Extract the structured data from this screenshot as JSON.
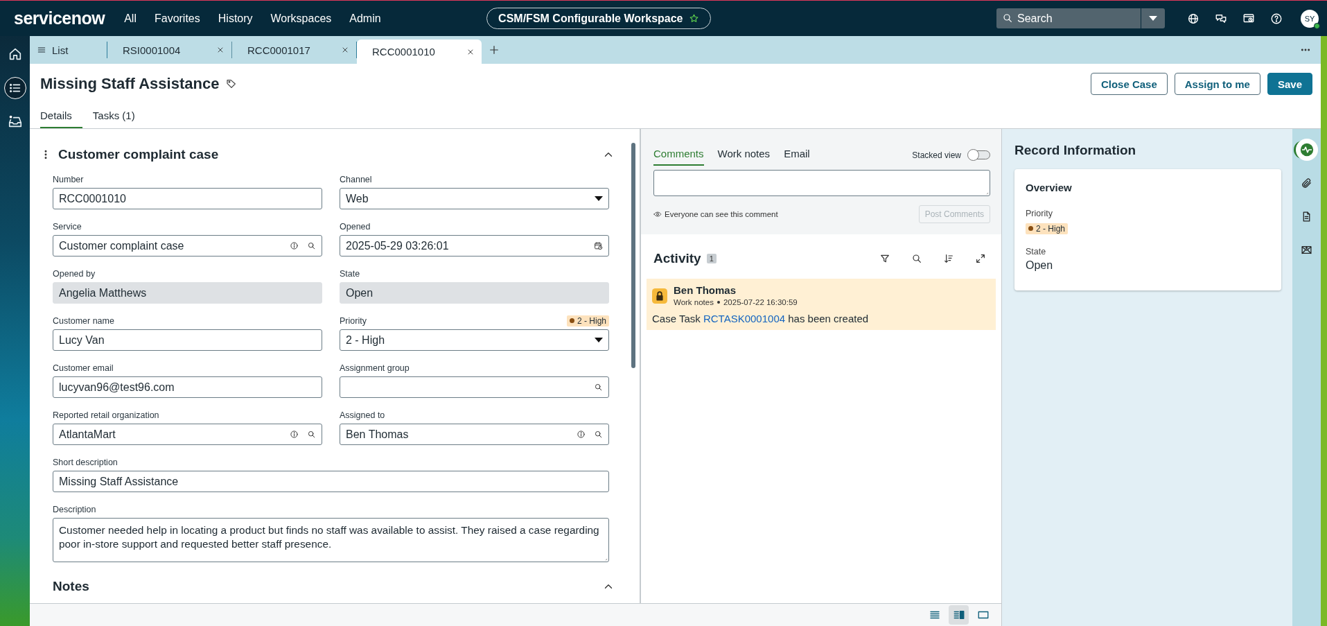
{
  "nav": {
    "logo": "servicenow",
    "menu": [
      "All",
      "Favorites",
      "History",
      "Workspaces",
      "Admin"
    ],
    "workspace": "CSM/FSM Configurable Workspace",
    "search": {
      "placeholder": "Search"
    },
    "avatar": "SY"
  },
  "left_rail": [
    {
      "kind": "home",
      "selected": false
    },
    {
      "kind": "list",
      "selected": true
    },
    {
      "kind": "inbox",
      "selected": false
    }
  ],
  "tabs": [
    {
      "label": "List",
      "kind": "list",
      "selected": false
    },
    {
      "label": "RSI0001004",
      "kind": "record",
      "selected": false
    },
    {
      "label": "RCC0001017",
      "kind": "record",
      "selected": false
    },
    {
      "label": "RCC0001010",
      "kind": "record",
      "selected": true
    }
  ],
  "record": {
    "title": "Missing Staff Assistance",
    "actions": [
      {
        "label": "Close Case",
        "kind": "secondary"
      },
      {
        "label": "Assign to me",
        "kind": "secondary"
      },
      {
        "label": "Save",
        "kind": "primary"
      }
    ],
    "tabs": [
      {
        "label": "Details",
        "selected": true
      },
      {
        "label": "Tasks (1)",
        "selected": false
      }
    ]
  },
  "form": {
    "section": "Customer complaint case",
    "fields": [
      {
        "label": "Number",
        "value": "RCC0001010",
        "kind": "text"
      },
      {
        "label": "Channel",
        "value": "Web",
        "kind": "select"
      },
      {
        "label": "Service",
        "value": "Customer complaint case",
        "kind": "reference"
      },
      {
        "label": "Opened",
        "value": "2025-05-29 03:26:01",
        "kind": "datetime"
      },
      {
        "label": "Opened by",
        "value": "Angelia Matthews",
        "kind": "readonly"
      },
      {
        "label": "State",
        "value": "Open",
        "kind": "readonly"
      },
      {
        "label": "Customer name",
        "value": "Lucy Van",
        "kind": "text"
      },
      {
        "label": "Priority",
        "value": "2 - High",
        "kind": "select",
        "badge": "2 - High"
      },
      {
        "label": "Customer email",
        "value": "lucyvan96@test96.com",
        "kind": "text"
      },
      {
        "label": "Assignment group",
        "kind": "search"
      },
      {
        "label": "Reported retail organization",
        "value": "AtlantaMart",
        "kind": "reference"
      },
      {
        "label": "Assigned to",
        "value": "Ben Thomas",
        "kind": "reference"
      },
      {
        "label": "Short description",
        "value": "Missing Staff Assistance",
        "kind": "text",
        "wide": true
      },
      {
        "label": "Description",
        "value": "Customer needed help in locating a product but finds no staff was available to assist. They raised a case regarding poor in-store support and requested better staff presence.",
        "kind": "textarea",
        "wide": true
      }
    ],
    "next_section": "Notes"
  },
  "composer": {
    "tabs": [
      {
        "label": "Comments",
        "selected": true
      },
      {
        "label": "Work notes",
        "selected": false
      },
      {
        "label": "Email",
        "selected": false
      }
    ],
    "stacked_view": {
      "label": "Stacked view",
      "on": false
    },
    "visibility_note": "Everyone can see this comment",
    "post_button": {
      "label": "Post Comments",
      "disabled": true
    }
  },
  "activity": {
    "title": "Activity",
    "count": "1",
    "entries": [
      {
        "author": "Ben Thomas",
        "type": "Work notes",
        "time": "2025-07-22 16:30:59",
        "message": [
          {
            "text": "Case Task",
            "kind": "text"
          },
          {
            "text": "RCTASK0001004",
            "kind": "link"
          },
          {
            "text": "has been created",
            "kind": "text"
          }
        ]
      }
    ]
  },
  "record_info": {
    "title": "Record Information",
    "card": "Overview",
    "fields": [
      {
        "label": "Priority",
        "value": "2 - High",
        "kind": "badge"
      },
      {
        "label": "State",
        "value": "Open",
        "kind": "text"
      }
    ]
  },
  "side_rail": [
    {
      "kind": "pulse",
      "selected": true
    },
    {
      "kind": "attachment",
      "selected": false
    },
    {
      "kind": "document",
      "selected": false
    },
    {
      "kind": "email",
      "selected": false
    }
  ],
  "view_switcher": [
    {
      "kind": "list",
      "selected": false
    },
    {
      "kind": "split",
      "selected": true
    },
    {
      "kind": "single",
      "selected": false
    }
  ]
}
